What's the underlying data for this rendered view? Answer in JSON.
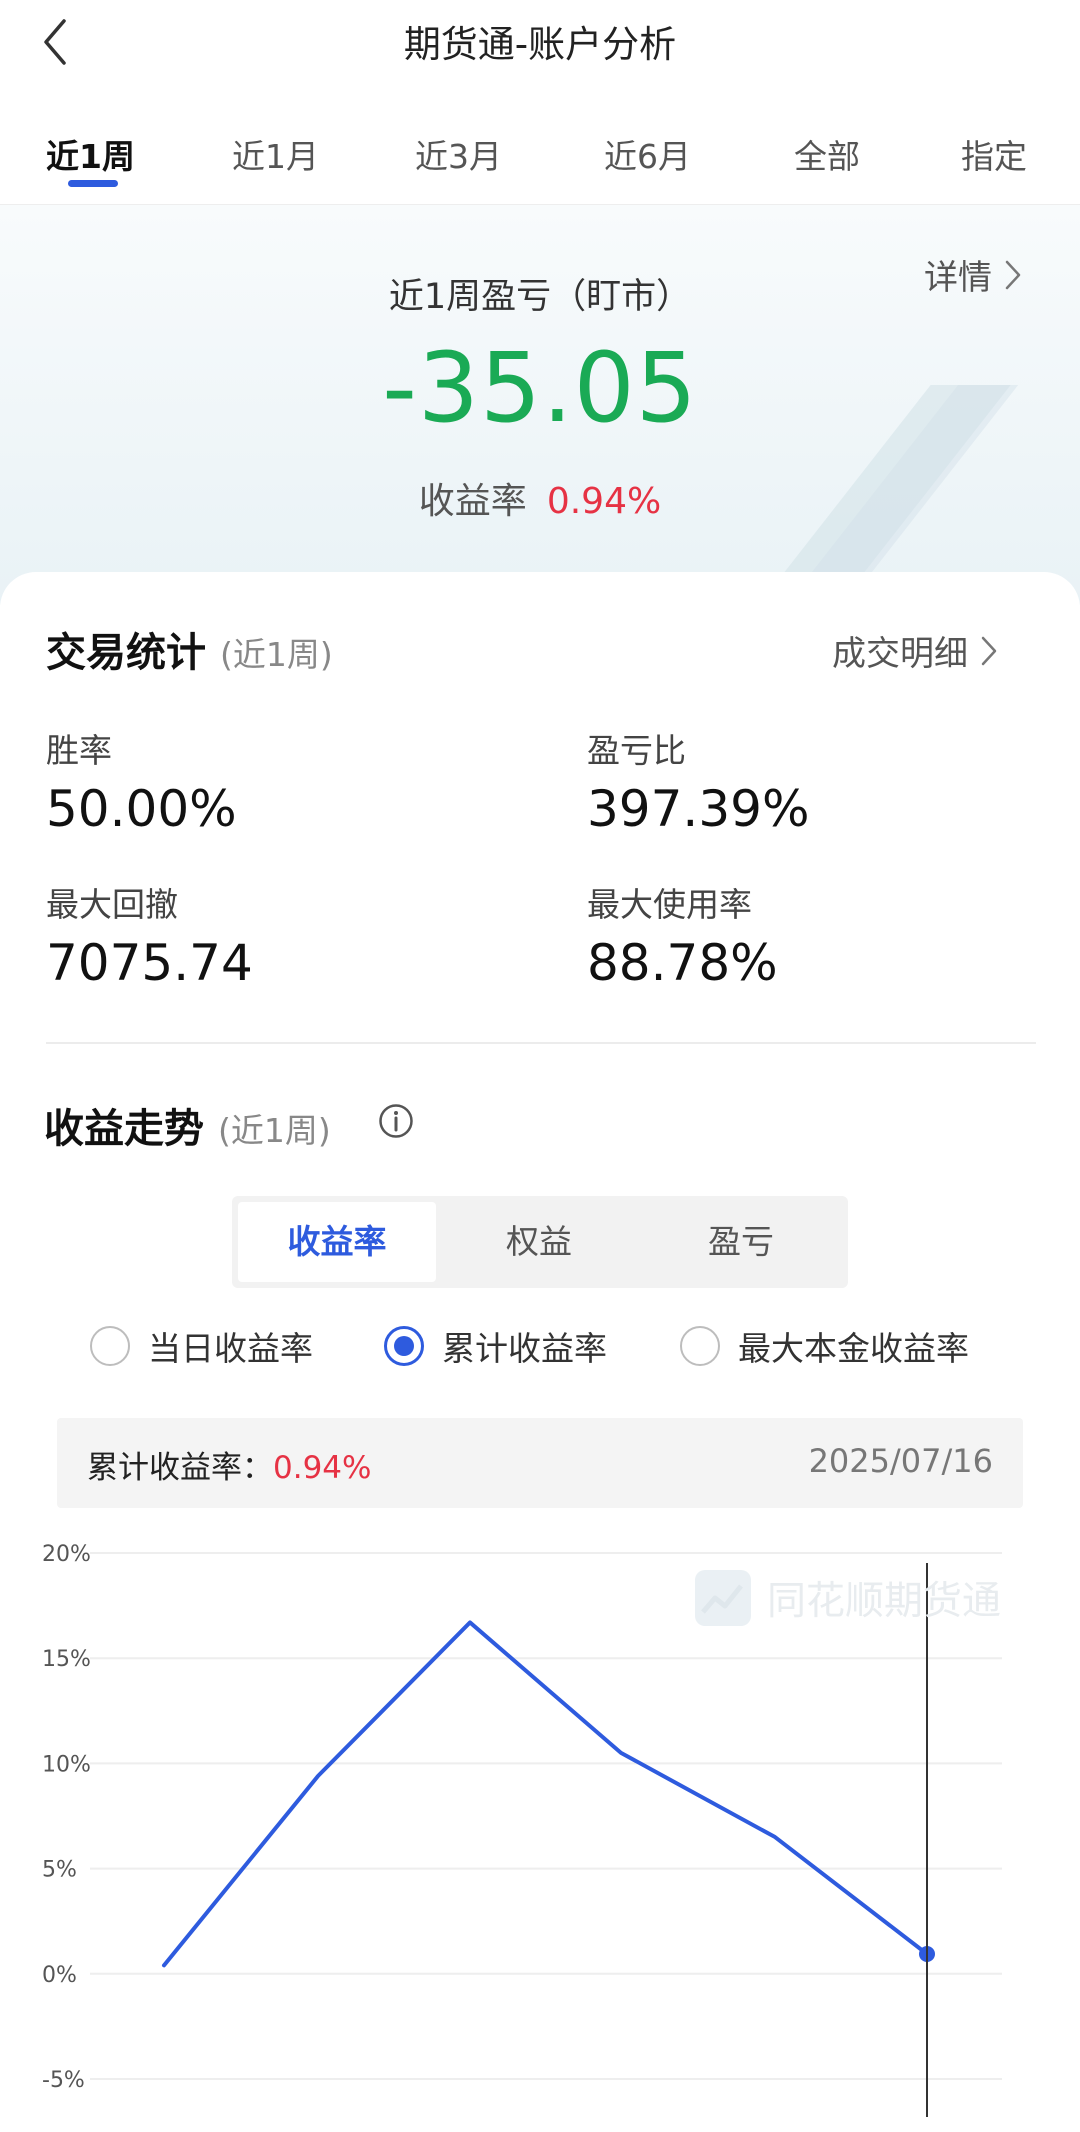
{
  "header": {
    "title": "期货通-账户分析",
    "back_icon": "chevron-left-icon"
  },
  "tabs": [
    {
      "label": "近1周",
      "active": true
    },
    {
      "label": "近1月",
      "active": false
    },
    {
      "label": "近3月",
      "active": false
    },
    {
      "label": "近6月",
      "active": false
    },
    {
      "label": "全部",
      "active": false
    },
    {
      "label": "指定",
      "active": false
    }
  ],
  "summary": {
    "label": "近1周盈亏（盯市）",
    "value": "-35.05",
    "rate_label": "收益率",
    "rate_value": "0.94%",
    "detail_label": "详情",
    "colors": {
      "loss": "#1aaa55",
      "gain": "#e63244"
    }
  },
  "trade_stats": {
    "title": "交易统计",
    "subtitle": "(近1周)",
    "link": "成交明细",
    "items": [
      {
        "label": "胜率",
        "value": "50.00%"
      },
      {
        "label": "盈亏比",
        "value": "397.39%"
      },
      {
        "label": "最大回撤",
        "value": "7075.74"
      },
      {
        "label": "最大使用率",
        "value": "88.78%"
      }
    ]
  },
  "trend": {
    "title": "收益走势",
    "subtitle": "(近1周)",
    "info_icon": "info-icon",
    "segments": [
      {
        "label": "收益率",
        "active": true
      },
      {
        "label": "权益",
        "active": false
      },
      {
        "label": "盈亏",
        "active": false
      }
    ],
    "radios": [
      {
        "label": "当日收益率",
        "checked": false
      },
      {
        "label": "累计收益率",
        "checked": true
      },
      {
        "label": "最大本金收益率",
        "checked": false
      }
    ],
    "readout_label": "累计收益率：",
    "readout_value": "0.94%",
    "readout_date": "2025/07/16",
    "watermark": "同花顺期货通",
    "accent": "#2e5bde"
  },
  "chart_data": {
    "type": "line",
    "title": "",
    "xlabel": "",
    "ylabel": "",
    "y_ticks": [
      "20%",
      "15%",
      "10%",
      "5%",
      "0%",
      "-5%"
    ],
    "ylim": [
      -5,
      20
    ],
    "grid": true,
    "series": [
      {
        "values": [
          0.4,
          9.4,
          16.7,
          10.5,
          6.5,
          0.94
        ]
      }
    ],
    "highlight_index": 5
  }
}
